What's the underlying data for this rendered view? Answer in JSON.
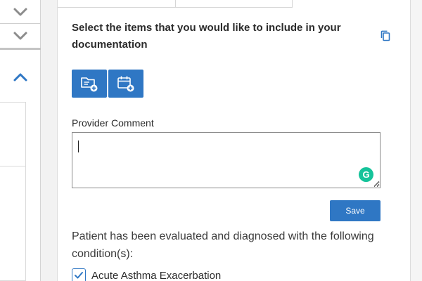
{
  "left_panel": {
    "icons": [
      "chevron-down-icon",
      "chevron-down-icon",
      "chevron-up-icon"
    ]
  },
  "main": {
    "heading": "Select the items that you would like to include in your documentation",
    "copy_icon": "copy-icon",
    "toolbar": {
      "buttons": [
        {
          "icon": "folder-add-icon"
        },
        {
          "icon": "calendar-add-icon"
        }
      ]
    },
    "provider_comment": {
      "label": "Provider Comment",
      "value": "",
      "placeholder": "",
      "grammarly_glyph": "G"
    },
    "save_label": "Save",
    "evaluation_text": "Patient has been evaluated and diagnosed with the following condition(s):",
    "conditions": [
      {
        "label": "Acute Asthma Exacerbation",
        "checked": true
      }
    ]
  },
  "colors": {
    "accent": "#2f77c4",
    "chevron": "#8c8c8c",
    "grammarly": "#15c39a"
  }
}
